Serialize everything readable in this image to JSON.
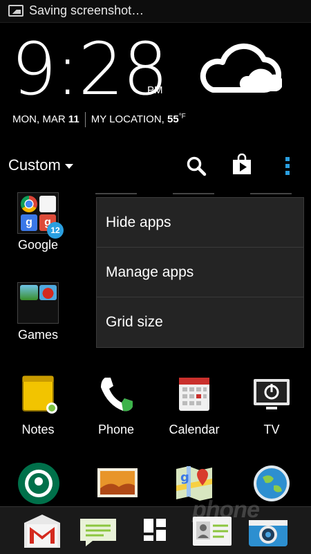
{
  "status_bar": {
    "notification_text": "Saving screenshot…",
    "icon": "screenshot-icon"
  },
  "clock_widget": {
    "time": "9:28",
    "ampm": "PM",
    "date_prefix": "MON, MAR ",
    "date_day": "11",
    "location_label": "MY LOCATION, ",
    "temperature": "55",
    "temp_unit": "°F",
    "weather_icon": "partly-cloudy-icon"
  },
  "toolbar": {
    "view_label": "Custom",
    "search_icon": "search-icon",
    "store_icon": "play-store-icon",
    "overflow_icon": "more-vertical-icon"
  },
  "apps": {
    "google": {
      "label": "Google",
      "badge": "12"
    },
    "games": {
      "label": "Games"
    },
    "notes": {
      "label": "Notes"
    },
    "phone": {
      "label": "Phone"
    },
    "calendar": {
      "label": "Calendar"
    },
    "tv": {
      "label": "TV"
    }
  },
  "menu": {
    "items": [
      "Hide apps",
      "Manage apps",
      "Grid size"
    ]
  },
  "colors": {
    "accent": "#2a9fe0",
    "background": "#000000",
    "menu_bg": "#242424"
  }
}
